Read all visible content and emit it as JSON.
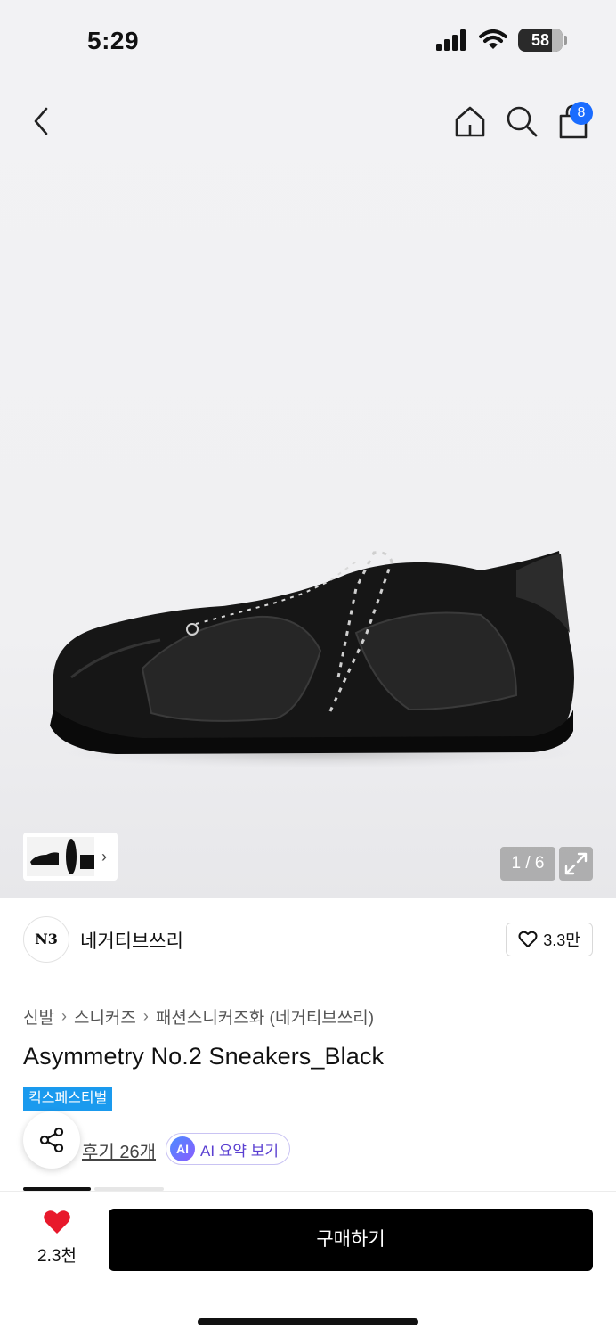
{
  "status_bar": {
    "time": "5:29",
    "battery": "58"
  },
  "nav": {
    "cart_count": "8"
  },
  "gallery": {
    "counter": "1 / 6"
  },
  "brand": {
    "logo_text": "N3",
    "name": "네거티브쓰리",
    "likes": "3.3만"
  },
  "breadcrumb": {
    "items": [
      "신발",
      "스니커즈",
      "패션스니커즈화 (네거티브쓰리)"
    ]
  },
  "product": {
    "title": "Asymmetry No.2 Sneakers_Black",
    "promo_tag": "킥스페스티벌",
    "review_link": "후기 26개",
    "ai_badge": "AI",
    "ai_summary": "AI 요약 보기"
  },
  "bottom_bar": {
    "wish_count": "2.3천",
    "buy_label": "구매하기"
  },
  "colors": {
    "accent_blue": "#1a6cff",
    "promo_blue": "#1a9aee",
    "heart_red": "#e8192c",
    "buy_black": "#000000",
    "ai_purple": "#5a3fd1"
  }
}
